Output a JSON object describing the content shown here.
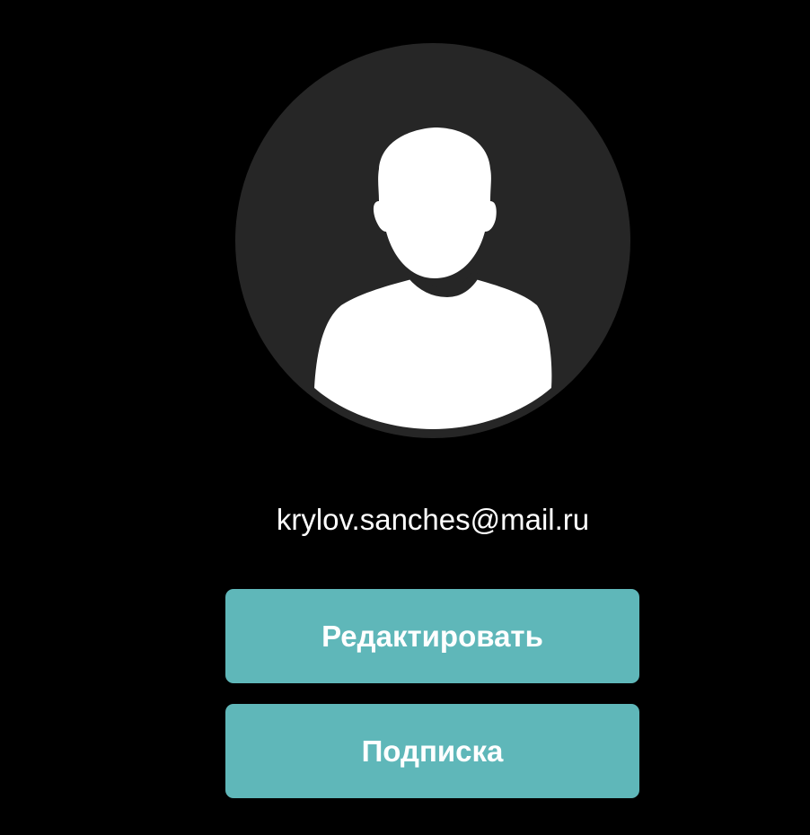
{
  "profile": {
    "avatar_icon": "user-silhouette-icon",
    "email": "krylov.sanches@mail.ru"
  },
  "actions": {
    "edit_label": "Редактировать",
    "subscription_label": "Подписка"
  },
  "colors": {
    "background": "#000000",
    "avatar_bg": "#262626",
    "button_bg": "#5fb7b9",
    "text": "#ffffff"
  }
}
